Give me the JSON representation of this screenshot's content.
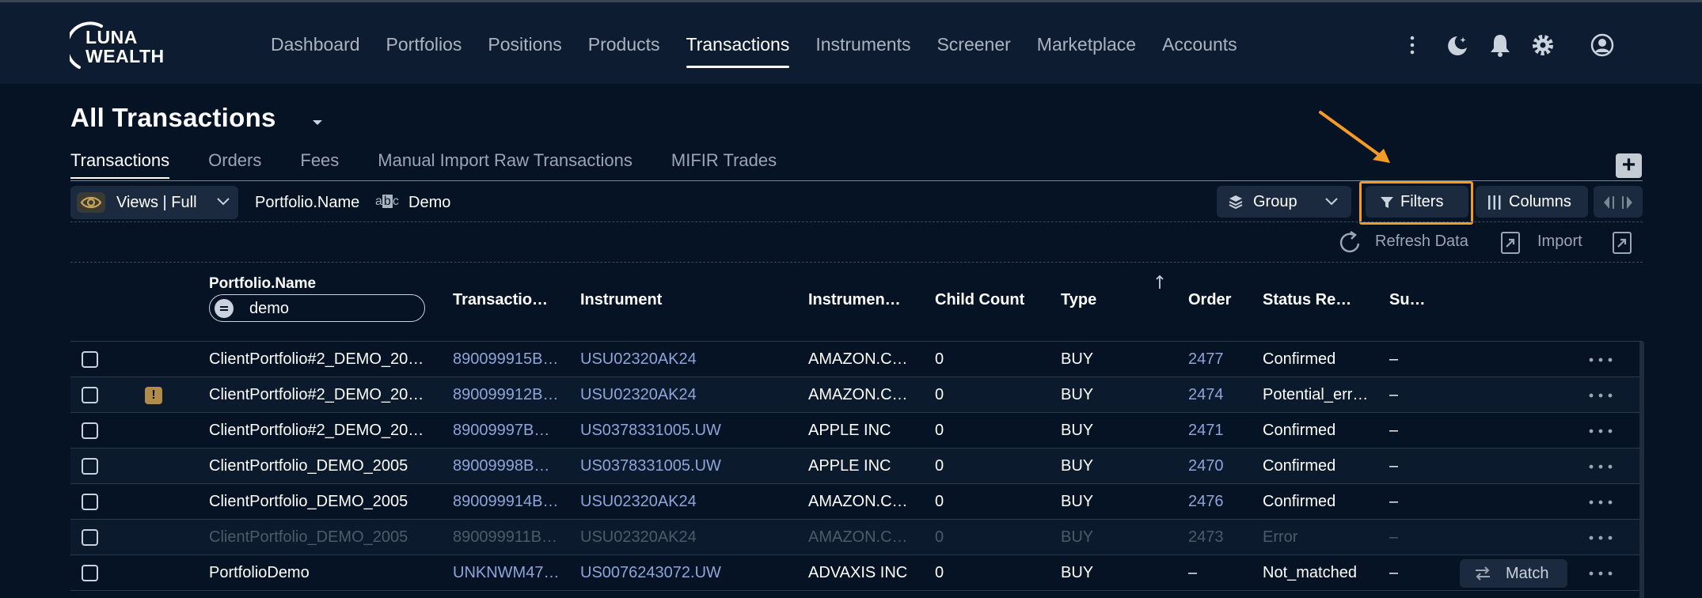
{
  "app": {
    "logo_line1": "LUNA",
    "logo_line2": "WEALTH"
  },
  "nav": {
    "items": [
      {
        "label": "Dashboard",
        "active": false
      },
      {
        "label": "Portfolios",
        "active": false
      },
      {
        "label": "Positions",
        "active": false
      },
      {
        "label": "Products",
        "active": false
      },
      {
        "label": "Transactions",
        "active": true
      },
      {
        "label": "Instruments",
        "active": false
      },
      {
        "label": "Screener",
        "active": false
      },
      {
        "label": "Marketplace",
        "active": false
      },
      {
        "label": "Accounts",
        "active": false
      }
    ]
  },
  "page": {
    "title": "All Transactions"
  },
  "subtabs": [
    {
      "label": "Transactions",
      "active": true
    },
    {
      "label": "Orders",
      "active": false
    },
    {
      "label": "Fees",
      "active": false
    },
    {
      "label": "Manual Import Raw Transactions",
      "active": false
    },
    {
      "label": "MIFIR Trades",
      "active": false
    }
  ],
  "toolbar": {
    "views_label": "Views | Full",
    "filter_field": "Portfolio.Name",
    "filter_type_icon": "abc-icon",
    "filter_value": "Demo",
    "group_label": "Group",
    "filters_label": "Filters",
    "columns_label": "Columns",
    "refresh_label": "Refresh Data",
    "import_label": "Import"
  },
  "table": {
    "name_header": "Portfolio.Name",
    "name_filter_value": "demo",
    "headers": {
      "transaction": "Transactio…",
      "instrument": "Instrument",
      "instrument_name": "Instrumen…",
      "child_count": "Child Count",
      "type": "Type",
      "order": "Order",
      "status": "Status Re…",
      "sub": "Su…"
    },
    "rows": [
      {
        "name": "ClientPortfolio#2_DEMO_20…",
        "transaction": "890099915B…",
        "instrument": "USU02320AK24",
        "instrument_name": "AMAZON.C…",
        "child_count": "0",
        "type": "BUY",
        "order": "2477",
        "status": "Confirmed",
        "sub": "–",
        "warn": false,
        "dim": false,
        "match": false
      },
      {
        "name": "ClientPortfolio#2_DEMO_20…",
        "transaction": "890099912B…",
        "instrument": "USU02320AK24",
        "instrument_name": "AMAZON.C…",
        "child_count": "0",
        "type": "BUY",
        "order": "2474",
        "status": "Potential_err…",
        "sub": "–",
        "warn": true,
        "dim": false,
        "match": false
      },
      {
        "name": "ClientPortfolio#2_DEMO_20…",
        "transaction": "89009997B…",
        "instrument": "US0378331005.UW",
        "instrument_name": "APPLE INC",
        "child_count": "0",
        "type": "BUY",
        "order": "2471",
        "status": "Confirmed",
        "sub": "–",
        "warn": false,
        "dim": false,
        "match": false
      },
      {
        "name": "ClientPortfolio_DEMO_2005",
        "transaction": "89009998B…",
        "instrument": "US0378331005.UW",
        "instrument_name": "APPLE INC",
        "child_count": "0",
        "type": "BUY",
        "order": "2470",
        "status": "Confirmed",
        "sub": "–",
        "warn": false,
        "dim": false,
        "match": false
      },
      {
        "name": "ClientPortfolio_DEMO_2005",
        "transaction": "890099914B…",
        "instrument": "USU02320AK24",
        "instrument_name": "AMAZON.C…",
        "child_count": "0",
        "type": "BUY",
        "order": "2476",
        "status": "Confirmed",
        "sub": "–",
        "warn": false,
        "dim": false,
        "match": false
      },
      {
        "name": "ClientPortfolio_DEMO_2005",
        "transaction": "890099911B…",
        "instrument": "USU02320AK24",
        "instrument_name": "AMAZON.C…",
        "child_count": "0",
        "type": "BUY",
        "order": "2473",
        "status": "Error",
        "sub": "–",
        "warn": false,
        "dim": true,
        "match": false
      },
      {
        "name": "PortfolioDemo",
        "transaction": "UNKNWM47…",
        "instrument": "US0076243072.UW",
        "instrument_name": "ADVAXIS INC",
        "child_count": "0",
        "type": "BUY",
        "order": "–",
        "status": "Not_matched",
        "sub": "–",
        "warn": false,
        "dim": false,
        "match": true,
        "match_label": "Match"
      }
    ]
  },
  "colors": {
    "background": "#061325",
    "topbar": "#0d1c31",
    "highlight": "#f39a27",
    "link": "#8fa4d8"
  }
}
